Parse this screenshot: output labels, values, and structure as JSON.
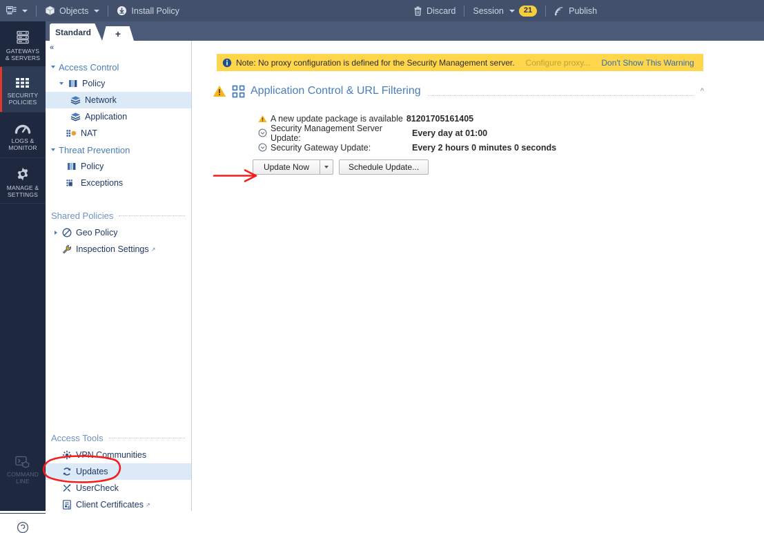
{
  "toolbar": {
    "menu_icon": "window-list-icon",
    "objects_label": "Objects",
    "install_policy_label": "Install Policy",
    "install_policy_icon": "download-circle-icon",
    "objects_icon": "cube-icon",
    "discard_label": "Discard",
    "discard_icon": "trash-icon",
    "session_label": "Session",
    "session_count": "21",
    "publish_label": "Publish",
    "publish_icon": "broadcast-icon",
    "badge_color": "#f3cf3f",
    "background_color": "#43506b"
  },
  "rail": {
    "items": [
      {
        "label": "Gateways\n& Servers",
        "line1": "GATEWAYS",
        "line2": "& SERVERS",
        "icon": "servers-icon",
        "selected": false
      },
      {
        "label": "Security Policies",
        "line1": "SECURITY",
        "line2": "POLICIES",
        "icon": "grid-blocks-icon",
        "selected": true
      },
      {
        "label": "Logs & Monitor",
        "line1": "LOGS &",
        "line2": "MONITOR",
        "icon": "gauge-icon",
        "selected": false
      },
      {
        "label": "Manage & Settings",
        "line1": "MANAGE &",
        "line2": "SETTINGS",
        "icon": "gear-icon",
        "selected": false
      }
    ],
    "command_line": {
      "line1": "COMMAND",
      "line2": "LINE",
      "icon": "terminal-cube-icon"
    },
    "selection_color": "#e03a2f",
    "background_color": "#1e2940"
  },
  "tabs": {
    "active_label": "Standard",
    "add_label": "+"
  },
  "nav": {
    "collapse_glyph": "«",
    "access_control": {
      "label": "Access Control",
      "items": [
        {
          "label": "Policy",
          "icon": "policy-book-icon",
          "expandable": true,
          "depth": 1
        },
        {
          "label": "Network",
          "icon": "layers-icon",
          "depth": 2,
          "selected": true
        },
        {
          "label": "Application",
          "icon": "layers-icon",
          "depth": 2
        },
        {
          "label": "NAT",
          "icon": "nat-grid-icon",
          "depth": 1
        }
      ]
    },
    "threat_prevention": {
      "label": "Threat Prevention",
      "items": [
        {
          "label": "Policy",
          "icon": "policy-book-icon",
          "depth": 1
        },
        {
          "label": "Exceptions",
          "icon": "exceptions-grid-icon",
          "depth": 1
        }
      ]
    },
    "shared_policies": {
      "label": "Shared Policies",
      "items": [
        {
          "label": "Geo Policy",
          "icon": "geo-circle-icon",
          "depth": 1,
          "expandable": true
        },
        {
          "label": "Inspection Settings",
          "icon": "wrench-icon",
          "depth": 1,
          "external": true
        }
      ]
    },
    "access_tools": {
      "label": "Access Tools",
      "items": [
        {
          "label": "VPN Communities",
          "icon": "vpn-star-icon",
          "depth": 1
        },
        {
          "label": "Updates",
          "icon": "refresh-icon",
          "depth": 1,
          "selected": true
        },
        {
          "label": "UserCheck",
          "icon": "usercheck-icon",
          "depth": 1
        },
        {
          "label": "Client Certificates",
          "icon": "certificate-icon",
          "depth": 1,
          "external": true
        }
      ]
    },
    "selected_row_color": "#dce9f7"
  },
  "notice": {
    "icon": "info-circle-icon",
    "text": "Note: No proxy configuration is defined for the Security Management server.",
    "configure_link": "Configure proxy...",
    "dismiss_link": "Don't Show This Warning",
    "background_color": "#ffd54a"
  },
  "section": {
    "warning_icon": "warning-triangle-icon",
    "section_icon": "four-squares-icon",
    "title": "Application Control & URL Filtering",
    "collapse_icon": "chevron-up-icon",
    "rows": [
      {
        "icon": "warning-triangle-icon",
        "label": "A new update package is available",
        "value": "81201705161405",
        "wide_label": false
      },
      {
        "icon": "clock-circle-icon",
        "label": "Security Management Server Update:",
        "value": "Every day at 01:00",
        "wide_label": false
      },
      {
        "icon": "clock-circle-icon",
        "label": "Security Gateway Update:",
        "value": "Every 2 hours 0 minutes 0 seconds",
        "wide_label": true
      }
    ],
    "update_now_label": "Update Now",
    "schedule_update_label": "Schedule Update..."
  },
  "annotations": {
    "arrow_color": "#f41c1c",
    "ellipse_color": "#f41c1c",
    "arrow_target": "Update Now",
    "ellipse_target": "Updates"
  }
}
